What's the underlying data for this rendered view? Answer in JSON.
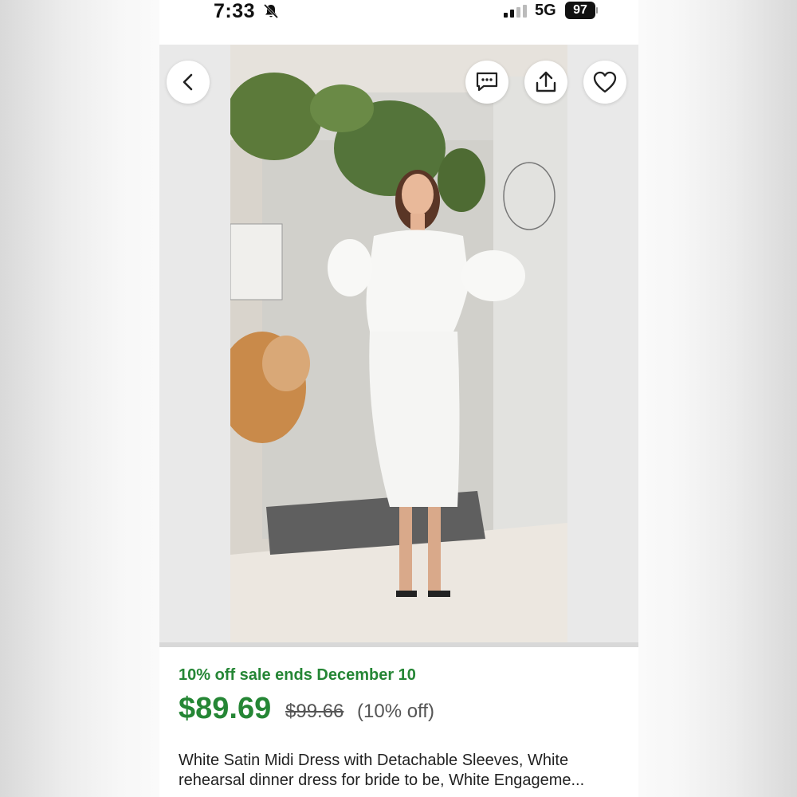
{
  "status_bar": {
    "time": "7:33",
    "network": "5G",
    "battery": "97"
  },
  "gallery": {
    "icons": {
      "back": "chevron-left-icon",
      "message": "message-icon",
      "share": "share-icon",
      "favorite": "heart-icon"
    }
  },
  "listing": {
    "sale_text": "10% off sale ends December 10",
    "price": "$89.69",
    "original_price": "$99.66",
    "discount": "(10% off)",
    "title": "White Satin Midi Dress with Detachable Sleeves, White rehearsal dinner dress for bride to be, White Engageme..."
  },
  "colors": {
    "sale_green": "#258635"
  }
}
